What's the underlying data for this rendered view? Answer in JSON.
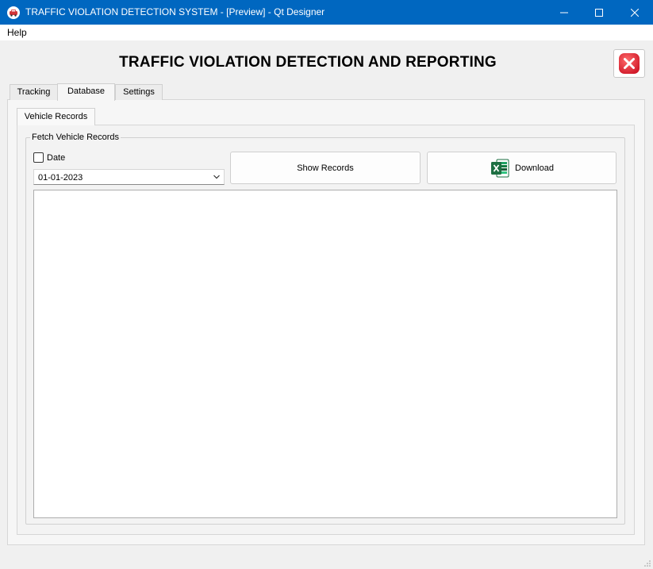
{
  "window": {
    "title": "TRAFFIC VIOLATION DETECTION SYSTEM - [Preview] - Qt Designer",
    "minimize_glyph": "–",
    "maximize_glyph": "☐",
    "close_glyph": "✕"
  },
  "menubar": {
    "items": [
      {
        "label": "Help"
      }
    ]
  },
  "header": {
    "title": "TRAFFIC VIOLATION DETECTION AND REPORTING",
    "exit_icon": "close-circle-icon",
    "exit_color": "#e81123"
  },
  "tabs": [
    {
      "label": "Tracking",
      "active": false
    },
    {
      "label": "Database",
      "active": true
    },
    {
      "label": "Settings",
      "active": false
    }
  ],
  "subtabs": [
    {
      "label": "Vehicle Records",
      "active": true
    }
  ],
  "fetch_group": {
    "title": "Fetch Vehicle Records",
    "date_checkbox": {
      "label": "Date",
      "checked": false
    },
    "date_value": "01-01-2023",
    "show_button": "Show Records",
    "download_button": "Download",
    "download_icon": "excel-icon",
    "excel_color": "#1d6f42"
  },
  "colors": {
    "titlebar": "#0067c0",
    "window_bg": "#f0f0f0"
  }
}
